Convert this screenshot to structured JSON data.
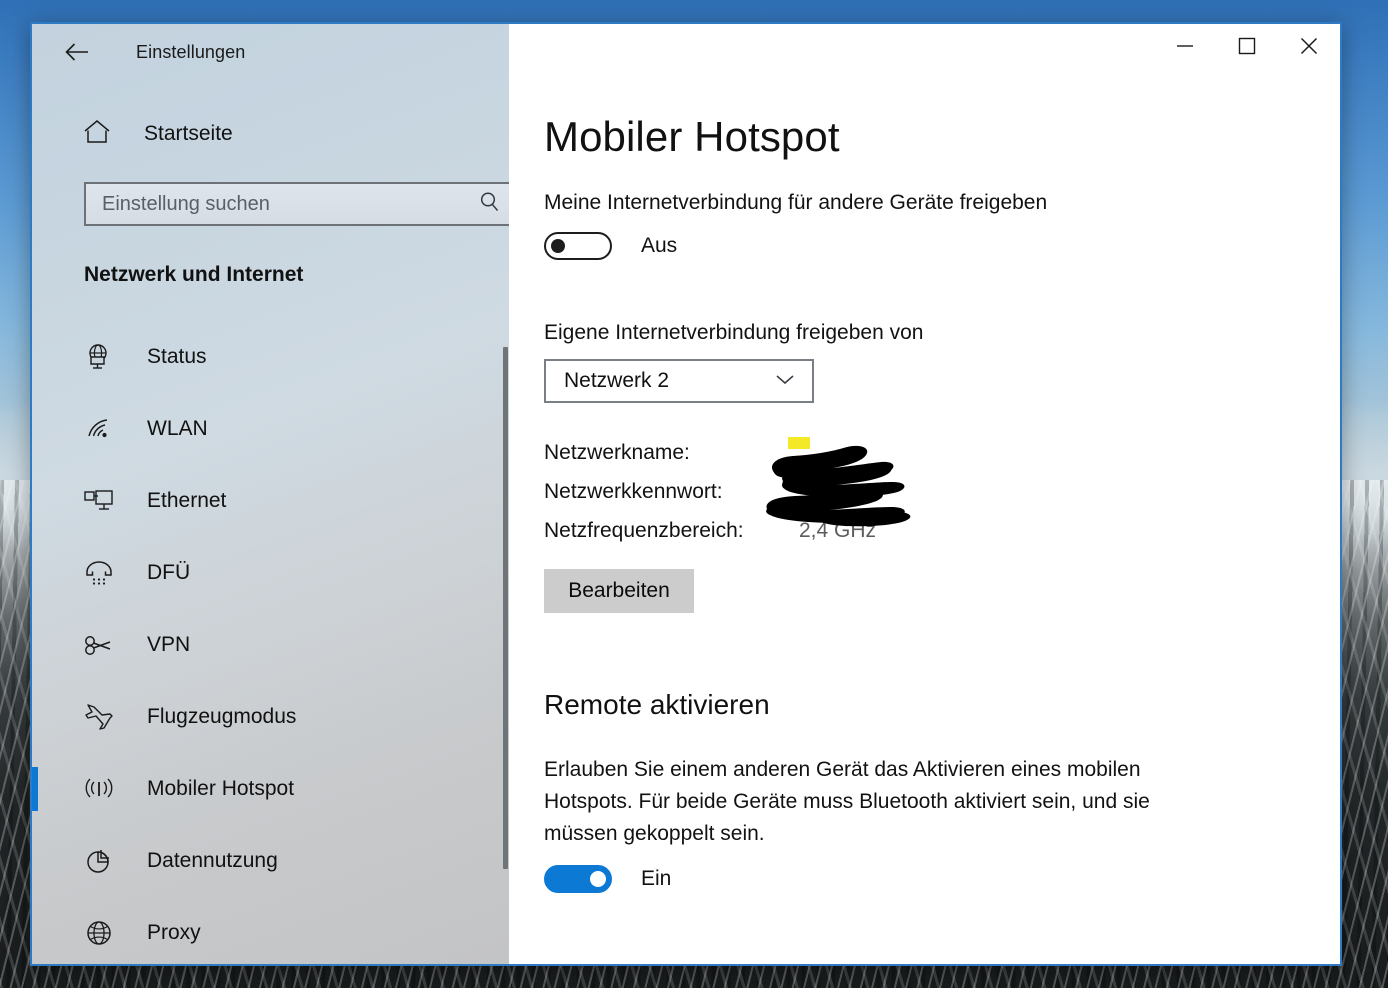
{
  "window": {
    "title": "Einstellungen",
    "back_icon": "back-arrow-icon",
    "minimize_label": "—",
    "maximize_label": "□",
    "close_label": "✕",
    "accent_color": "#0c7ad4",
    "border_color": "#2e7ac4"
  },
  "sidebar": {
    "home": {
      "label": "Startseite",
      "icon": "home-icon"
    },
    "search": {
      "placeholder": "Einstellung suchen",
      "value": "",
      "icon": "search-icon"
    },
    "category_title": "Netzwerk und Internet",
    "items": [
      {
        "label": "Status",
        "icon": "globe-monitor-icon",
        "selected": false
      },
      {
        "label": "WLAN",
        "icon": "wifi-icon",
        "selected": false
      },
      {
        "label": "Ethernet",
        "icon": "ethernet-icon",
        "selected": false
      },
      {
        "label": "DFÜ",
        "icon": "dialup-phone-icon",
        "selected": false
      },
      {
        "label": "VPN",
        "icon": "vpn-key-icon",
        "selected": false
      },
      {
        "label": "Flugzeugmodus",
        "icon": "airplane-icon",
        "selected": false
      },
      {
        "label": "Mobiler Hotspot",
        "icon": "hotspot-broadcast-icon",
        "selected": true
      },
      {
        "label": "Datennutzung",
        "icon": "pie-chart-icon",
        "selected": false
      },
      {
        "label": "Proxy",
        "icon": "globe-icon",
        "selected": false
      }
    ]
  },
  "main": {
    "page_title": "Mobiler Hotspot",
    "share_label": "Meine Internetverbindung für andere Geräte freigeben",
    "share_toggle_state": "Aus",
    "share_from_label": "Eigene Internetverbindung freigeben von",
    "dropdown_value": "Netzwerk 2",
    "dropdown_icon": "chevron-down-icon",
    "details": [
      {
        "key": "Netzwerkname:",
        "value": "",
        "redacted": true
      },
      {
        "key": "Netzwerkkennwort:",
        "value": "",
        "redacted": true
      },
      {
        "key": "Netzfrequenzbereich:",
        "value": "2,4 GHz",
        "redacted": false
      }
    ],
    "edit_button_label": "Bearbeiten",
    "remote_heading": "Remote aktivieren",
    "remote_description": "Erlauben Sie einem anderen Gerät das Aktivieren eines mobilen Hotspots. Für beide Geräte muss Bluetooth aktiviert sein, und sie müssen gekoppelt sein.",
    "remote_toggle_state": "Ein"
  }
}
